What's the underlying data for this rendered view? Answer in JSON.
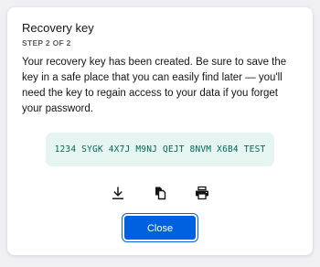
{
  "dialog": {
    "title": "Recovery key",
    "step": "STEP 2 OF 2",
    "description": "Your recovery key has been created. Be sure to save the key in a safe place that you can easily find later — you'll need the key to regain access to your data if you forget your password.",
    "recovery_key": "1234 SYGK 4X7J M9NJ QEJT 8NVM X6B4 TEST",
    "actions": {
      "download_icon": "download-icon",
      "copy_icon": "copy-icon",
      "print_icon": "print-icon"
    },
    "close_label": "Close"
  },
  "colors": {
    "accent": "#0061e0",
    "key_background": "#e6f5f2",
    "key_text": "#00685a"
  }
}
